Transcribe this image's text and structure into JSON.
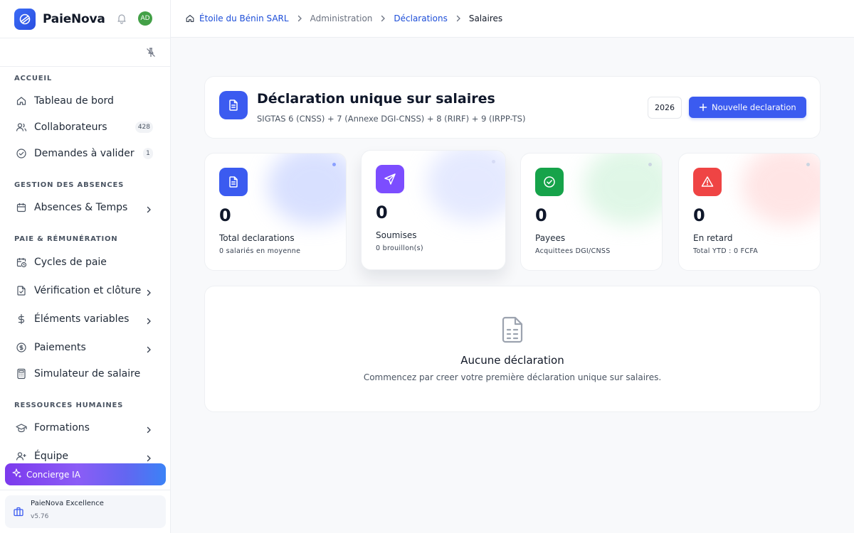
{
  "app": {
    "name": "PaieNova",
    "user_initials": "AD"
  },
  "breadcrumb": {
    "company": "Étoile du Bénin SARL",
    "administration": "Administration",
    "declarations": "Déclarations",
    "current": "Salaires"
  },
  "sidebar": {
    "sections": {
      "accueil": "ACCUEIL",
      "absences": "GESTION DES ABSENCES",
      "paie": "PAIE & RÉMUNÉRATION",
      "rh": "RESSOURCES HUMAINES"
    },
    "items": {
      "tableau_de_bord": "Tableau de bord",
      "collaborateurs": "Collaborateurs",
      "collaborateurs_badge": "428",
      "demandes": "Demandes à valider",
      "demandes_badge": "1",
      "absences": "Absences & Temps",
      "cycles": "Cycles de paie",
      "verification": "Vérification et clôture",
      "elements": "Éléments variables",
      "paiements": "Paiements",
      "simulateur": "Simulateur de salaire",
      "formations": "Formations",
      "equipe": "Équipe"
    },
    "concierge": "Concierge IA",
    "version_title": "PaieNova Excellence",
    "version": "v5.76"
  },
  "header": {
    "title": "Déclaration unique sur salaires",
    "subtitle": "SIGTAS 6 (CNSS) + 7 (Annexe DGI-CNSS) + 8 (RIRF) + 9 (IRPP-TS)",
    "year": "2026",
    "new_button": "Nouvelle declaration"
  },
  "stats": [
    {
      "value": "0",
      "label": "Total declarations",
      "sub": "0 salariés en moyenne",
      "icon": "document-icon",
      "color": "#3b5bf0"
    },
    {
      "value": "0",
      "label": "Soumises",
      "sub": "0 brouillon(s)",
      "icon": "send-icon",
      "color": "#7c4dff"
    },
    {
      "value": "0",
      "label": "Payees",
      "sub": "Acquittees DGI/CNSS",
      "icon": "check-circle-icon",
      "color": "#16a34a"
    },
    {
      "value": "0",
      "label": "En retard",
      "sub": "Total YTD : 0 FCFA",
      "icon": "warning-icon",
      "color": "#ef4444"
    }
  ],
  "empty": {
    "title": "Aucune déclaration",
    "subtitle": "Commencez par creer votre première déclaration unique sur salaires."
  }
}
